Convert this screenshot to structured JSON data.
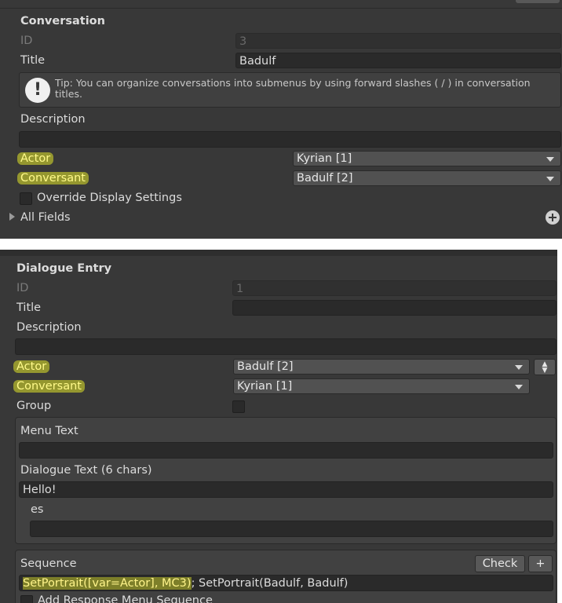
{
  "conversation": {
    "header": "Conversation",
    "id_label": "ID",
    "id_value": "3",
    "title_label": "Title",
    "title_value": "Badulf",
    "tip_text": "Tip: You can organize conversations into submenus by using forward slashes ( / ) in conversation titles.",
    "description_label": "Description",
    "description_value": "",
    "actor_label": "Actor",
    "actor_value": "Kyrian [1]",
    "conversant_label": "Conversant",
    "conversant_value": "Badulf [2]",
    "override_label": "Override Display Settings",
    "all_fields_label": "All Fields"
  },
  "dialogue_entry": {
    "header": "Dialogue Entry",
    "id_label": "ID",
    "id_value": "1",
    "title_label": "Title",
    "title_value": "",
    "description_label": "Description",
    "description_value": "",
    "actor_label": "Actor",
    "actor_value": "Badulf [2]",
    "conversant_label": "Conversant",
    "conversant_value": "Kyrian [1]",
    "group_label": "Group",
    "menu_text_label": "Menu Text",
    "menu_text_value": "",
    "dialogue_text_label": "Dialogue Text (6 chars)",
    "dialogue_text_value": "Hello!",
    "es_label": "es",
    "es_value": "",
    "sequence_label": "Sequence",
    "check_label": "Check",
    "plus_label": "+",
    "sequence_part1": "SetPortrait([var=Actor], MC3)",
    "sequence_part2": "; SetPortrait(Badulf, Badulf)",
    "add_response_label": "Add Response Menu Sequence"
  },
  "colors": {
    "panel_bg": "#383838",
    "field_bg": "#2a2a2a",
    "highlight": "#e2e628"
  }
}
